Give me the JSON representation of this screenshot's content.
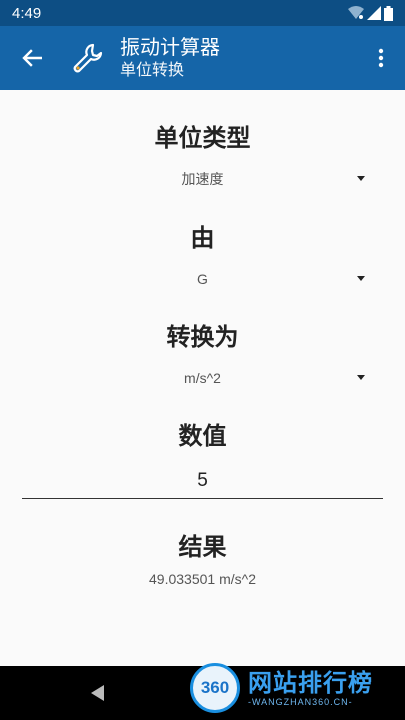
{
  "status_bar": {
    "time": "4:49"
  },
  "app_bar": {
    "title": "振动计算器",
    "subtitle": "单位转换"
  },
  "form": {
    "unit_type_label": "单位类型",
    "unit_type_value": "加速度",
    "from_label": "由",
    "from_value": "G",
    "to_label": "转换为",
    "to_value": "m/s^2",
    "value_label": "数值",
    "value_input": "5",
    "result_label": "结果",
    "result_value": "49.033501 m/s^2"
  },
  "watermark": {
    "badge": "360",
    "main": "网站排行榜",
    "sub": "-WANGZHAN360.CN-"
  },
  "colors": {
    "status_bar": "#0d4e84",
    "app_bar": "#1565a8",
    "background": "#fafafa"
  }
}
